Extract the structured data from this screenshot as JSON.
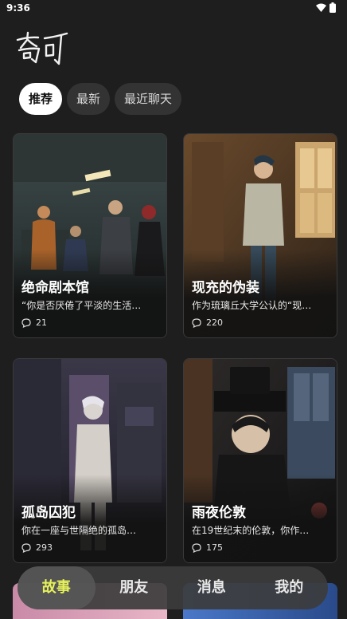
{
  "status": {
    "time": "9:36"
  },
  "app": {
    "logo_text": "奇可"
  },
  "tabs": [
    {
      "label": "推荐",
      "active": true
    },
    {
      "label": "最新",
      "active": false
    },
    {
      "label": "最近聊天",
      "active": false
    }
  ],
  "cards": [
    {
      "title": "绝命剧本馆",
      "desc": "“你是否厌倦了平淡的生活…",
      "count": "21"
    },
    {
      "title": "现充的伪装",
      "desc": "作为琉璃丘大学公认的“现…",
      "count": "220"
    },
    {
      "title": "孤岛囚犯",
      "desc": "你在一座与世隔绝的孤岛…",
      "count": "293"
    },
    {
      "title": "雨夜伦敦",
      "desc": "在19世纪末的伦敦，你作…",
      "count": "175"
    }
  ],
  "nav": [
    {
      "label": "故事",
      "active": true
    },
    {
      "label": "朋友",
      "active": false
    },
    {
      "label": "消息",
      "active": false
    },
    {
      "label": "我的",
      "active": false
    }
  ],
  "colors": {
    "accent": "#e6f25a",
    "background": "#1e1e1e"
  }
}
